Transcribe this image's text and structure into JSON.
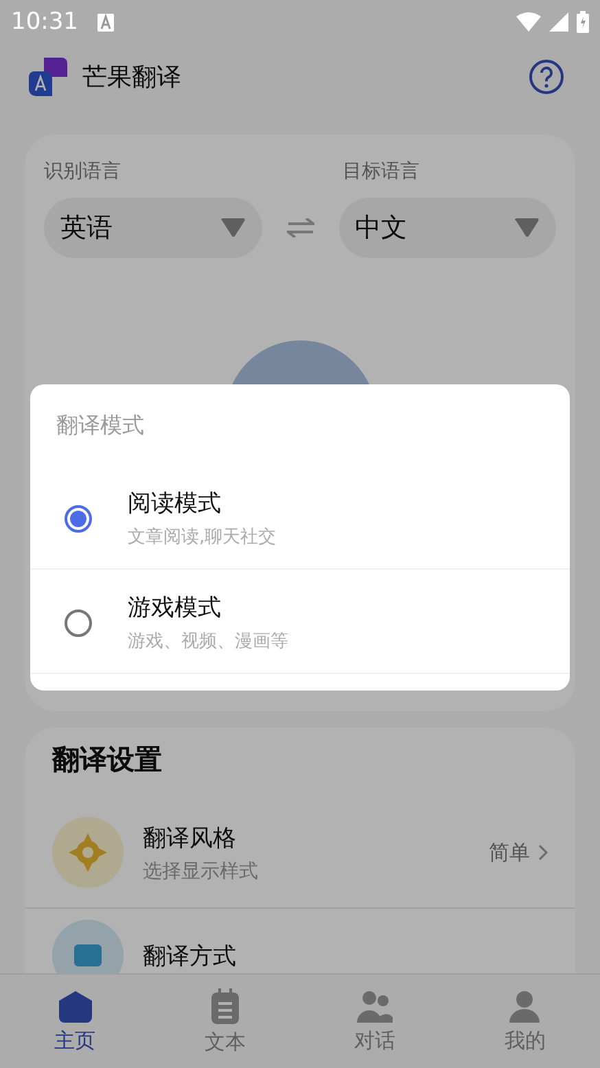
{
  "status_bar": {
    "time": "10:31"
  },
  "app_bar": {
    "title": "芒果翻译"
  },
  "languages": {
    "source_label": "识别语言",
    "source": "英语",
    "target_label": "目标语言",
    "target": "中文"
  },
  "dialog": {
    "title": "翻译模式",
    "options": [
      {
        "title": "阅读模式",
        "subtitle": "文章阅读,聊天社交",
        "selected": true
      },
      {
        "title": "游戏模式",
        "subtitle": "游戏、视频、漫画等",
        "selected": false
      }
    ]
  },
  "settings": {
    "title": "翻译设置",
    "items": [
      {
        "kind": "style",
        "title": "翻译风格",
        "subtitle": "选择显示样式",
        "value": "简单"
      },
      {
        "kind": "method",
        "title": "翻译方式"
      }
    ]
  },
  "nav": [
    {
      "kind": "home",
      "label": "主页",
      "selected": true
    },
    {
      "kind": "text",
      "label": "文本",
      "selected": false
    },
    {
      "kind": "chat",
      "label": "对话",
      "selected": false
    },
    {
      "kind": "me",
      "label": "我的",
      "selected": false
    }
  ]
}
